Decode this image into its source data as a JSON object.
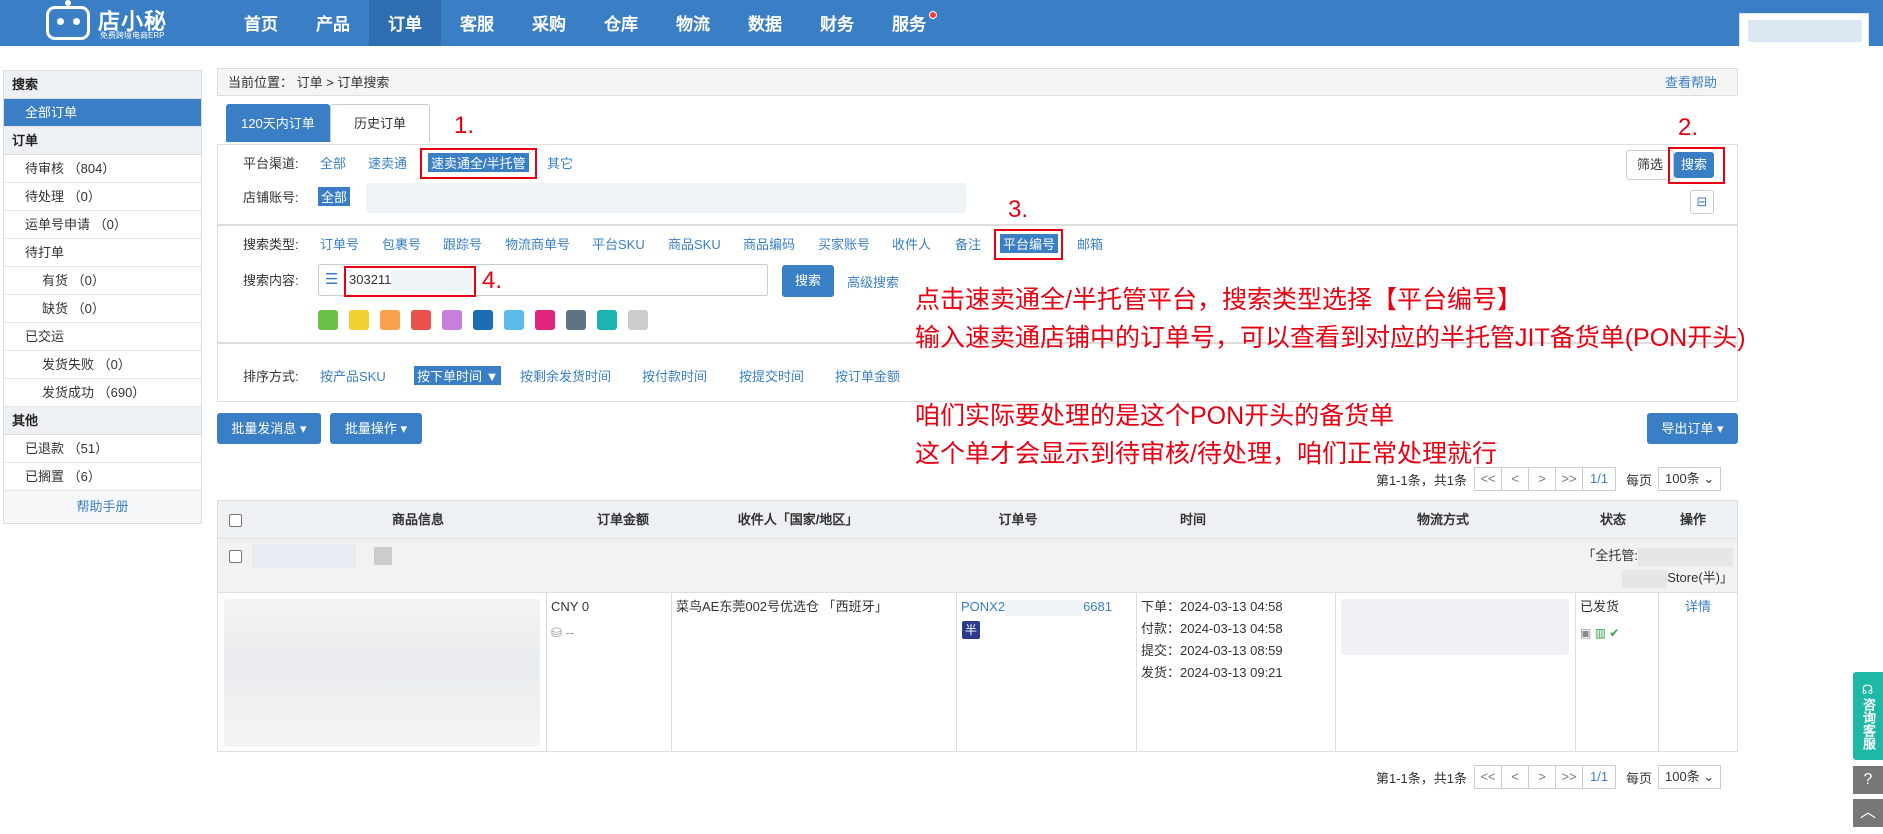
{
  "brand": {
    "name": "店小秘",
    "slogan": "免费跨境电商ERP"
  },
  "nav": {
    "items": [
      "首页",
      "产品",
      "订单",
      "客服",
      "采购",
      "仓库",
      "物流",
      "数据",
      "财务",
      "服务"
    ],
    "active_index": 2
  },
  "sidebar": {
    "sections": [
      {
        "title": "搜索",
        "rows": [
          {
            "label": "全部订单",
            "active": true
          }
        ]
      },
      {
        "title": "订单",
        "rows": [
          {
            "label": "待审核 （804）"
          },
          {
            "label": "待处理 （0）"
          },
          {
            "label": "运单号申请 （0）"
          },
          {
            "label": "待打单"
          },
          {
            "label": "有货 （0）",
            "sub": true
          },
          {
            "label": "缺货 （0）",
            "sub": true
          },
          {
            "label": "已交运"
          },
          {
            "label": "发货失败 （0）",
            "sub": true
          },
          {
            "label": "发货成功 （690）",
            "sub": true
          }
        ]
      },
      {
        "title": "其他",
        "rows": [
          {
            "label": "已退款 （51）"
          },
          {
            "label": "已搁置 （6）"
          }
        ]
      }
    ],
    "help": "帮助手册"
  },
  "breadcrumb": {
    "text": "当前位置：  订单 > 订单搜索",
    "help": "查看帮助"
  },
  "tabs": [
    "120天内订单",
    "历史订单"
  ],
  "filters": {
    "channel_label": "平台渠道:",
    "channel_options": [
      "全部",
      "速卖通",
      "速卖通全/半托管",
      "其它"
    ],
    "account_label": "店铺账号:",
    "account_all": "全部",
    "search_type_label": "搜索类型:",
    "search_types": [
      "订单号",
      "包裹号",
      "跟踪号",
      "物流商单号",
      "平台SKU",
      "商品SKU",
      "商品编码",
      "买家账号",
      "收件人",
      "备注",
      "平台编号",
      "邮箱"
    ],
    "content_label": "搜索内容:",
    "content_value": "303211",
    "search_btn": "搜索",
    "advanced": "高级搜索",
    "sort_label": "排序方式:",
    "sort_options": [
      "按产品SKU",
      "按下单时间 ▼",
      "按剩余发货时间",
      "按付款时间",
      "按提交时间",
      "按订单金额"
    ],
    "screen_btn": "筛选",
    "top_search_btn": "搜索",
    "swatches": [
      "#6cbf4b",
      "#f1d032",
      "#f7a24a",
      "#e9524a",
      "#c77fdc",
      "#1d6db5",
      "#5bbbe8",
      "#e0257a",
      "#5e7483",
      "#1db3b5",
      "#cccccc"
    ]
  },
  "annotations": {
    "marks": [
      "1.",
      "2.",
      "3.",
      "4."
    ],
    "lines": [
      "点击速卖通全/半托管平台，搜索类型选择【平台编号】",
      "输入速卖通店铺中的订单号，可以查看到对应的半托管JIT备货单(PON开头)",
      "咱们实际要处理的是这个PON开头的备货单",
      "这个单才会显示到待审核/待处理，咱们正常处理就行"
    ]
  },
  "actions": {
    "batch_msg": "批量发消息 ▾",
    "batch_ops": "批量操作 ▾",
    "export": "导出订单 ▾"
  },
  "pager": {
    "summary": "第1-1条，共1条",
    "buttons": [
      "<<",
      "<",
      ">",
      ">>"
    ],
    "current": "1/1",
    "per_page_label": "每页",
    "per_page": "100条 ⌄"
  },
  "table": {
    "headers": [
      "商品信息",
      "订单金额",
      "收件人「国家/地区」",
      "订单号",
      "时间",
      "物流方式",
      "状态",
      "操作"
    ],
    "group_tag_line1": "「全托管:",
    "group_tag_line2": "Store(半)」",
    "row": {
      "amount": "CNY 0",
      "amount_sub": "--",
      "recipient": "菜鸟AE东莞002号优选仓 「西班牙」",
      "order_prefix": "PONX2",
      "order_suffix": "6681",
      "half_badge": "半",
      "times": [
        "下单：2024-03-13 04:58",
        "付款：2024-03-13 04:58",
        "提交：2024-03-13 08:59",
        "发货：2024-03-13 09:21"
      ],
      "status": "已发货",
      "op": "详情"
    }
  },
  "float": {
    "consult": "咨询客服",
    "help": "?",
    "top": "︿"
  }
}
